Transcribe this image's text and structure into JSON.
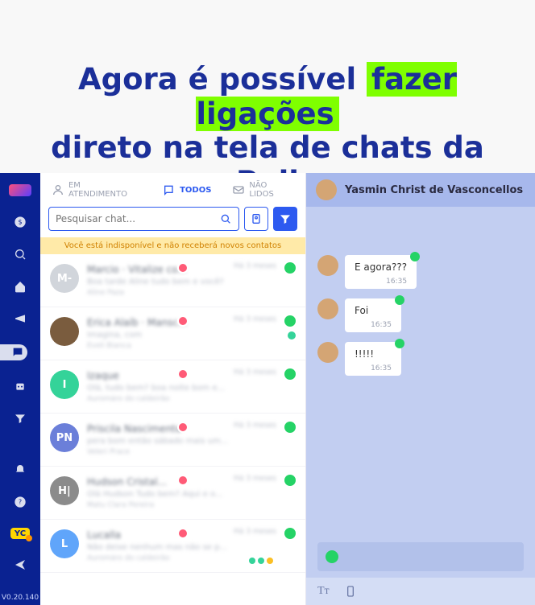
{
  "headline": {
    "part1": "Agora é possível ",
    "highlight": "fazer ligações",
    "part2": "direto na tela de chats da Poli"
  },
  "sidebar": {
    "yc": "YC",
    "version": "V0.20.140"
  },
  "tabs": {
    "em": "EM ATENDIMENTO",
    "todos": "TODOS",
    "nao": "NÃO LIDOS"
  },
  "search": {
    "placeholder": "Pesquisar chat..."
  },
  "banner": "Você está indisponível e não receberá novos contatos",
  "chats": [
    {
      "init": "M-",
      "bg": "#d1d5db",
      "name": "Marcio · Vitalize co...",
      "sub": "Boa tarde Aline tudo bem e você?",
      "meta": "Aline Paza",
      "time": "Há 3 meses"
    },
    {
      "init": "",
      "bg": "#7a5c3e",
      "name": "Erica Alaíb · Mansc...",
      "sub": "Imagina, com",
      "meta": "Eveli Bianca",
      "time": "Há 3 meses",
      "green": true,
      "img": true
    },
    {
      "init": "I",
      "bg": "#34d399",
      "name": "Izaque",
      "sub": "Olá, tudo bem? boa noite bom e...",
      "meta": "Auromáro do caldeirão",
      "time": "Há 3 meses"
    },
    {
      "init": "PN",
      "bg": "#6b7fd9",
      "name": "Priscila Nascimento",
      "sub": "pera bom então sábado mais um...",
      "meta": "Veleri Prace",
      "time": "Há 3 meses"
    },
    {
      "init": "H|",
      "bg": "#8b8b8b",
      "name": "Hudson Cristal...",
      "sub": "Olá Hudson Tudo bem? Aqui e o...",
      "meta": "Matu Clara Pereira",
      "time": "Há 3 meses"
    },
    {
      "init": "L",
      "bg": "#60a5fa",
      "name": "Lucalla",
      "sub": "Não deixe nenhum mas não se p...",
      "meta": "Auromáro do caldeirão",
      "time": "Há 3 meses",
      "multi": true
    }
  ],
  "chat": {
    "name": "Yasmin Christ de Vasconcellos",
    "messages": [
      {
        "text": "E agora???",
        "time": "16:35"
      },
      {
        "text": "Foi",
        "time": "16:35"
      },
      {
        "text": "!!!!!",
        "time": "16:35"
      }
    ]
  }
}
